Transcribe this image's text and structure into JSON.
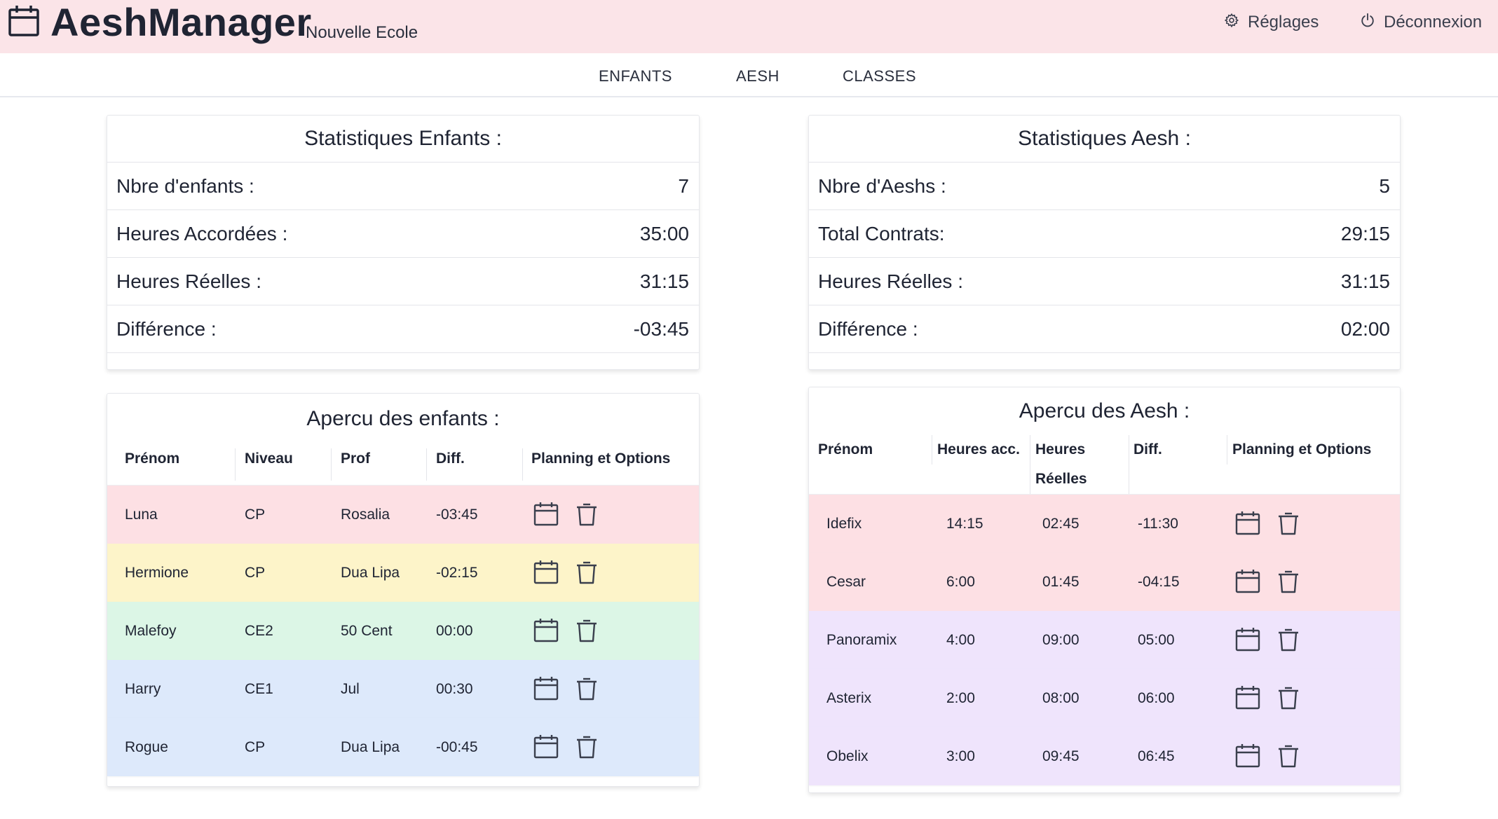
{
  "app": {
    "title": "AeshManager",
    "school": "Nouvelle Ecole",
    "settings_label": "Réglages",
    "logout_label": "Déconnexion",
    "header_bg": "#fbe4e8"
  },
  "nav": {
    "items": [
      {
        "label": "ENFANTS"
      },
      {
        "label": "AESH"
      },
      {
        "label": "CLASSES"
      }
    ]
  },
  "stats_enfants": {
    "title": "Statistiques Enfants :",
    "rows": [
      {
        "label": "Nbre d'enfants :",
        "value": "7"
      },
      {
        "label": "Heures Accordées :",
        "value": "35:00"
      },
      {
        "label": "Heures Réelles :",
        "value": "31:15"
      },
      {
        "label": "Différence :",
        "value": "-03:45"
      }
    ]
  },
  "stats_aesh": {
    "title": "Statistiques Aesh :",
    "rows": [
      {
        "label": "Nbre d'Aeshs :",
        "value": "5"
      },
      {
        "label": "Total Contrats:",
        "value": "29:15"
      },
      {
        "label": "Heures Réelles :",
        "value": "31:15"
      },
      {
        "label": "Différence :",
        "value": "02:00"
      }
    ]
  },
  "enfants_table": {
    "title": "Apercu des enfants :",
    "headers": [
      "Prénom",
      "Niveau",
      "Prof",
      "Diff.",
      "Planning et Options"
    ],
    "rows": [
      {
        "prenom": "Luna",
        "niveau": "CP",
        "prof": "Rosalia",
        "diff": "-03:45",
        "color": "#fde0e4"
      },
      {
        "prenom": "Hermione",
        "niveau": "CP",
        "prof": "Dua Lipa",
        "diff": "-02:15",
        "color": "#fdf4c9"
      },
      {
        "prenom": "Malefoy",
        "niveau": "CE2",
        "prof": "50 Cent",
        "diff": "00:00",
        "color": "#dcf6e6"
      },
      {
        "prenom": "Harry",
        "niveau": "CE1",
        "prof": "Jul",
        "diff": "00:30",
        "color": "#dde9fb"
      },
      {
        "prenom": "Rogue",
        "niveau": "CP",
        "prof": "Dua Lipa",
        "diff": "-00:45",
        "color": "#dde9fb"
      }
    ]
  },
  "aesh_table": {
    "title": "Apercu des Aesh :",
    "headers": [
      "Prénom",
      "Heures acc.",
      "Heures",
      "Réelles",
      "Diff.",
      "Planning et Options"
    ],
    "rows": [
      {
        "prenom": "Idefix",
        "heures_acc": "14:15",
        "heures_reelles": "02:45",
        "diff": "-11:30",
        "color": "#fde0e4"
      },
      {
        "prenom": "Cesar",
        "heures_acc": "6:00",
        "heures_reelles": "01:45",
        "diff": "-04:15",
        "color": "#fde0e4"
      },
      {
        "prenom": "Panoramix",
        "heures_acc": "4:00",
        "heures_reelles": "09:00",
        "diff": "05:00",
        "color": "#efe4fc"
      },
      {
        "prenom": "Asterix",
        "heures_acc": "2:00",
        "heures_reelles": "08:00",
        "diff": "06:00",
        "color": "#efe4fc"
      },
      {
        "prenom": "Obelix",
        "heures_acc": "3:00",
        "heures_reelles": "09:45",
        "diff": "06:45",
        "color": "#efe4fc"
      }
    ]
  },
  "icons": {
    "brand": "calendar-icon",
    "settings": "gear-icon",
    "logout": "power-icon",
    "planning": "calendar-icon",
    "delete": "trash-icon"
  }
}
